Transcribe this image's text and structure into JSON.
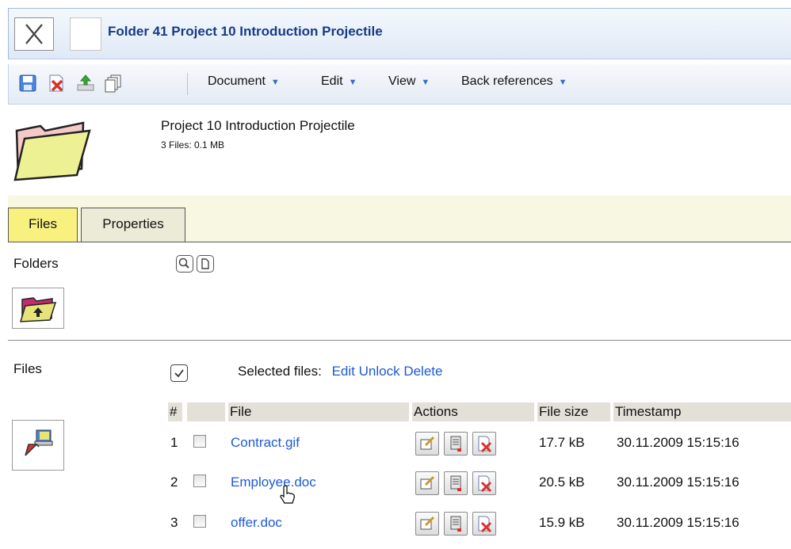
{
  "window": {
    "title": "Folder 41 Project 10 Introduction Projectile"
  },
  "toolbar": {
    "icons": [
      "save-icon",
      "delete-icon",
      "upload-icon",
      "copy-icon"
    ],
    "menus": [
      "Document",
      "Edit",
      "View",
      "Back references"
    ],
    "menu_arrow": "▼"
  },
  "folder": {
    "name": "Project 10 Introduction Projectile",
    "meta": "3 Files: 0.1 MB"
  },
  "tabs": [
    "Files",
    "Properties"
  ],
  "sections": {
    "folders_label": "Folders",
    "files_label": "Files"
  },
  "selection": {
    "label": "Selected files:",
    "actions": [
      "Edit",
      "Unlock",
      "Delete"
    ]
  },
  "table": {
    "columns": [
      "#",
      "",
      "File",
      "Actions",
      "File size",
      "Timestamp"
    ],
    "rows": [
      {
        "num": "1",
        "file": "Contract.gif",
        "size": "17.7 kB",
        "timestamp": "30.11.2009 15:15:16"
      },
      {
        "num": "2",
        "file": "Employee.doc",
        "size": "20.5 kB",
        "timestamp": "30.11.2009 15:15:16"
      },
      {
        "num": "3",
        "file": "offer.doc",
        "size": "15.9 kB",
        "timestamp": "30.11.2009 15:15:16"
      }
    ]
  },
  "colors": {
    "title_text": "#173a86",
    "link": "#1d5bd6",
    "active_tab": "#f8f17f",
    "band": "#f7f7e2"
  }
}
